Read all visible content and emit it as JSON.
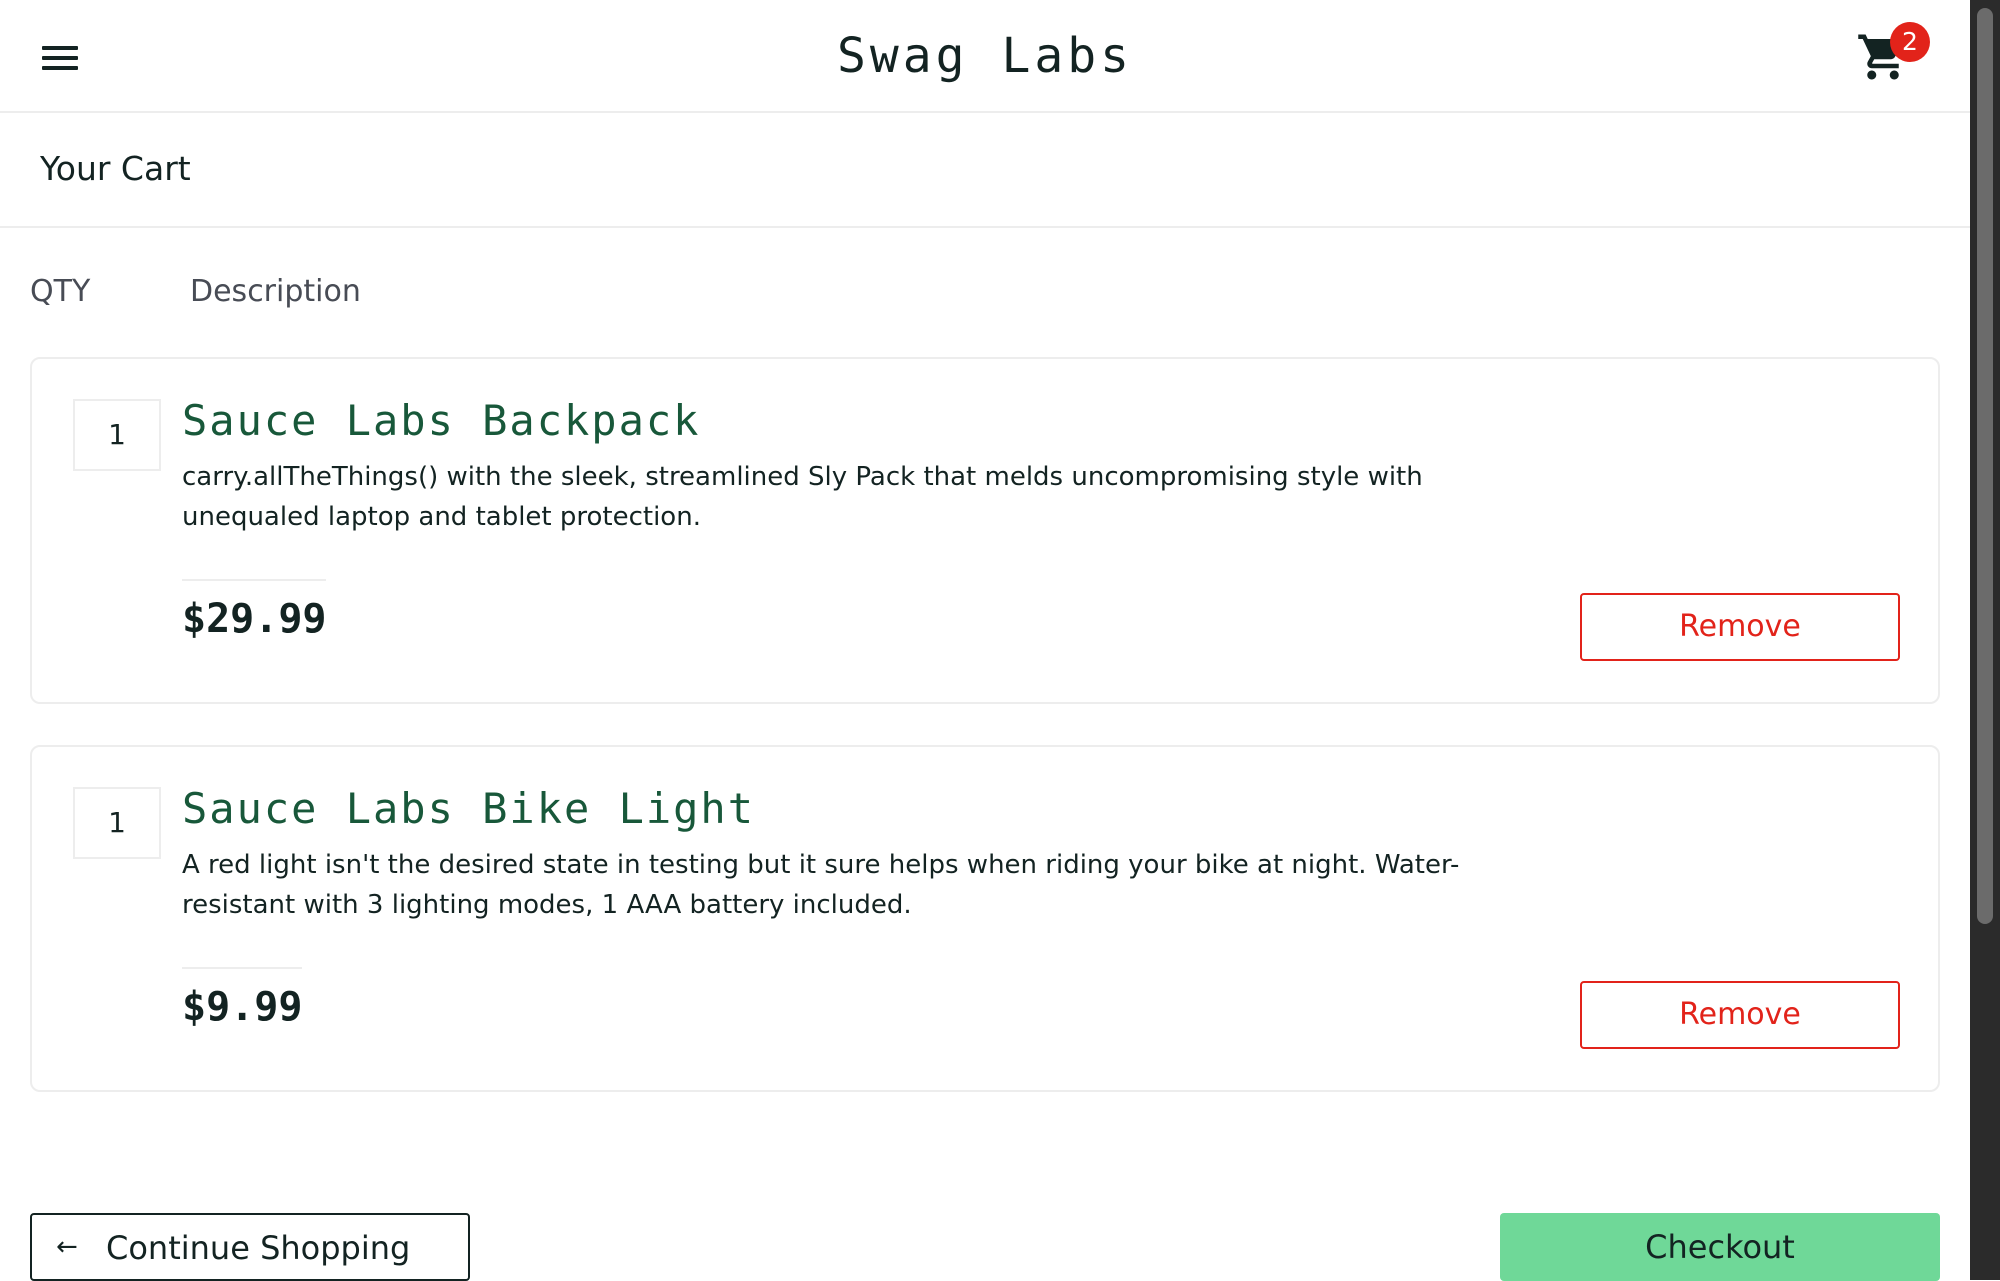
{
  "header": {
    "title": "Swag Labs",
    "cart_count": "2"
  },
  "page": {
    "title": "Your Cart"
  },
  "columns": {
    "qty": "QTY",
    "description": "Description"
  },
  "items": [
    {
      "qty": "1",
      "name": "Sauce Labs Backpack",
      "description": "carry.allTheThings() with the sleek, streamlined Sly Pack that melds uncompromising style with unequaled laptop and tablet protection.",
      "price": "$29.99",
      "remove_label": "Remove"
    },
    {
      "qty": "1",
      "name": "Sauce Labs Bike Light",
      "description": "A red light isn't the desired state in testing but it sure helps when riding your bike at night. Water-resistant with 3 lighting modes, 1 AAA battery included.",
      "price": "$9.99",
      "remove_label": "Remove"
    }
  ],
  "footer": {
    "continue_label": "Continue Shopping",
    "checkout_label": "Checkout"
  },
  "icons": {
    "menu": "hamburger-menu-icon",
    "cart": "shopping-cart-icon",
    "back": "arrow-left-icon"
  },
  "colors": {
    "accent_green": "#6fd898",
    "item_name_green": "#18583a",
    "remove_red": "#e2231a",
    "badge_red": "#e2231a",
    "text_dark": "#132322"
  }
}
